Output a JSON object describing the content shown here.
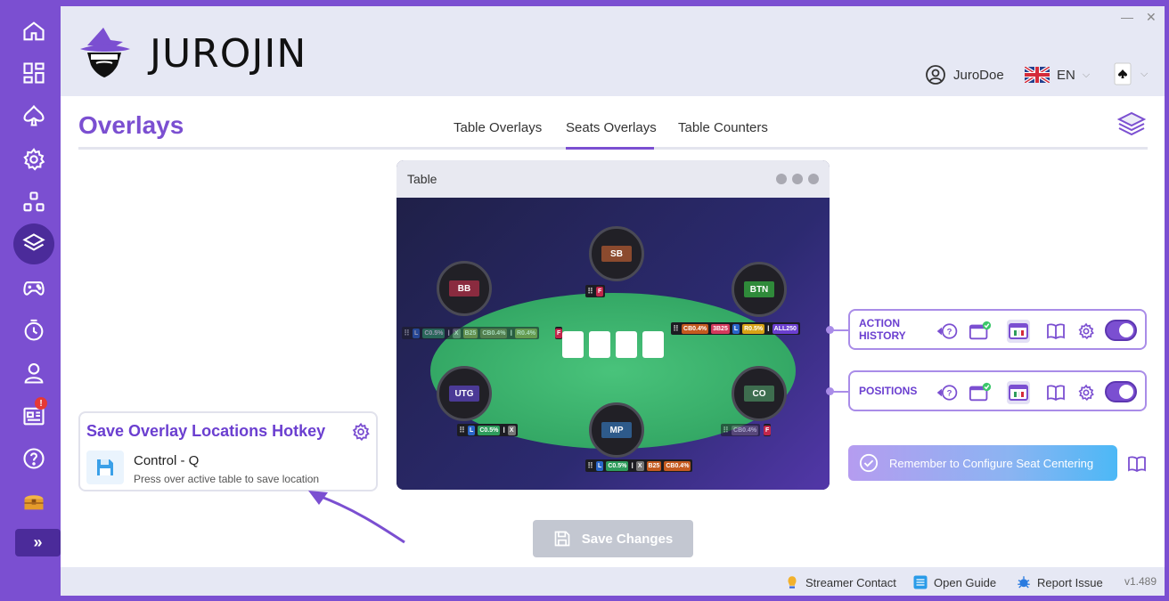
{
  "app": {
    "name": "JUROJIN",
    "version": "v1.489",
    "window_controls": {
      "minimize": "—",
      "close": "✕"
    }
  },
  "colors": {
    "brand": "#7b4fd1",
    "brand_dark": "#4b2b9a",
    "panel_border": "#a98ce8",
    "felt": "#3bb36e"
  },
  "sidebar": {
    "items": [
      {
        "icon": "home-icon",
        "active": false
      },
      {
        "icon": "dashboard-icon",
        "active": false
      },
      {
        "icon": "spade-icon",
        "active": false
      },
      {
        "icon": "gear-icon",
        "active": false
      },
      {
        "icon": "hotkeys-icon",
        "active": false
      },
      {
        "icon": "layers-icon",
        "active": true
      },
      {
        "icon": "gamepad-icon",
        "active": false
      },
      {
        "icon": "timer-icon",
        "active": false
      },
      {
        "icon": "user-icon",
        "active": false
      },
      {
        "icon": "news-icon",
        "active": false,
        "badge": "!"
      },
      {
        "icon": "help-icon",
        "active": false
      },
      {
        "icon": "treasure-chest-icon",
        "active": false
      }
    ],
    "expand_label": "»"
  },
  "header": {
    "username": "JuroDoe",
    "language": "EN"
  },
  "page": {
    "title": "Overlays",
    "tabs": [
      "Table Overlays",
      "Seats Overlays",
      "Table Counters"
    ],
    "active_tab": "Seats Overlays"
  },
  "table_preview": {
    "title": "Table",
    "seats": [
      {
        "name": "SB",
        "color": "#8b4a2e"
      },
      {
        "name": "BB",
        "color": "#8a2b3f"
      },
      {
        "name": "BTN",
        "color": "#2f8a3a"
      },
      {
        "name": "UTG",
        "color": "#4b3a96"
      },
      {
        "name": "CO",
        "color": "#3e6d4f"
      },
      {
        "name": "MP",
        "color": "#2e5a8a"
      }
    ],
    "huds": {
      "sb": [
        "F"
      ],
      "bb": [
        "L",
        "C0.5%",
        "X",
        "B25",
        "CB0.4%",
        "R0.4%",
        "F"
      ],
      "btn": [
        "CB0.4%",
        "3B25",
        "L",
        "R0.5%",
        "ALL250"
      ],
      "utg": [
        "L",
        "C0.5%",
        "X"
      ],
      "co": [
        "CB0.4%",
        "F"
      ],
      "mp": [
        "L",
        "C0.5%",
        "X",
        "B25",
        "CB0.4%"
      ]
    }
  },
  "panels": [
    {
      "label_line1": "ACTION",
      "label_line2": "HISTORY",
      "enabled": true
    },
    {
      "label_line1": "POSITIONS",
      "label_line2": "",
      "enabled": true
    }
  ],
  "reminder": {
    "text": "Remember to Configure Seat Centering"
  },
  "hotkey": {
    "title": "Save Overlay Locations Hotkey",
    "key": "Control - Q",
    "description": "Press over active table to save location"
  },
  "save_button": {
    "label": "Save Changes"
  },
  "footer": {
    "streamer_contact": "Streamer Contact",
    "open_guide": "Open Guide",
    "report_issue": "Report Issue"
  }
}
